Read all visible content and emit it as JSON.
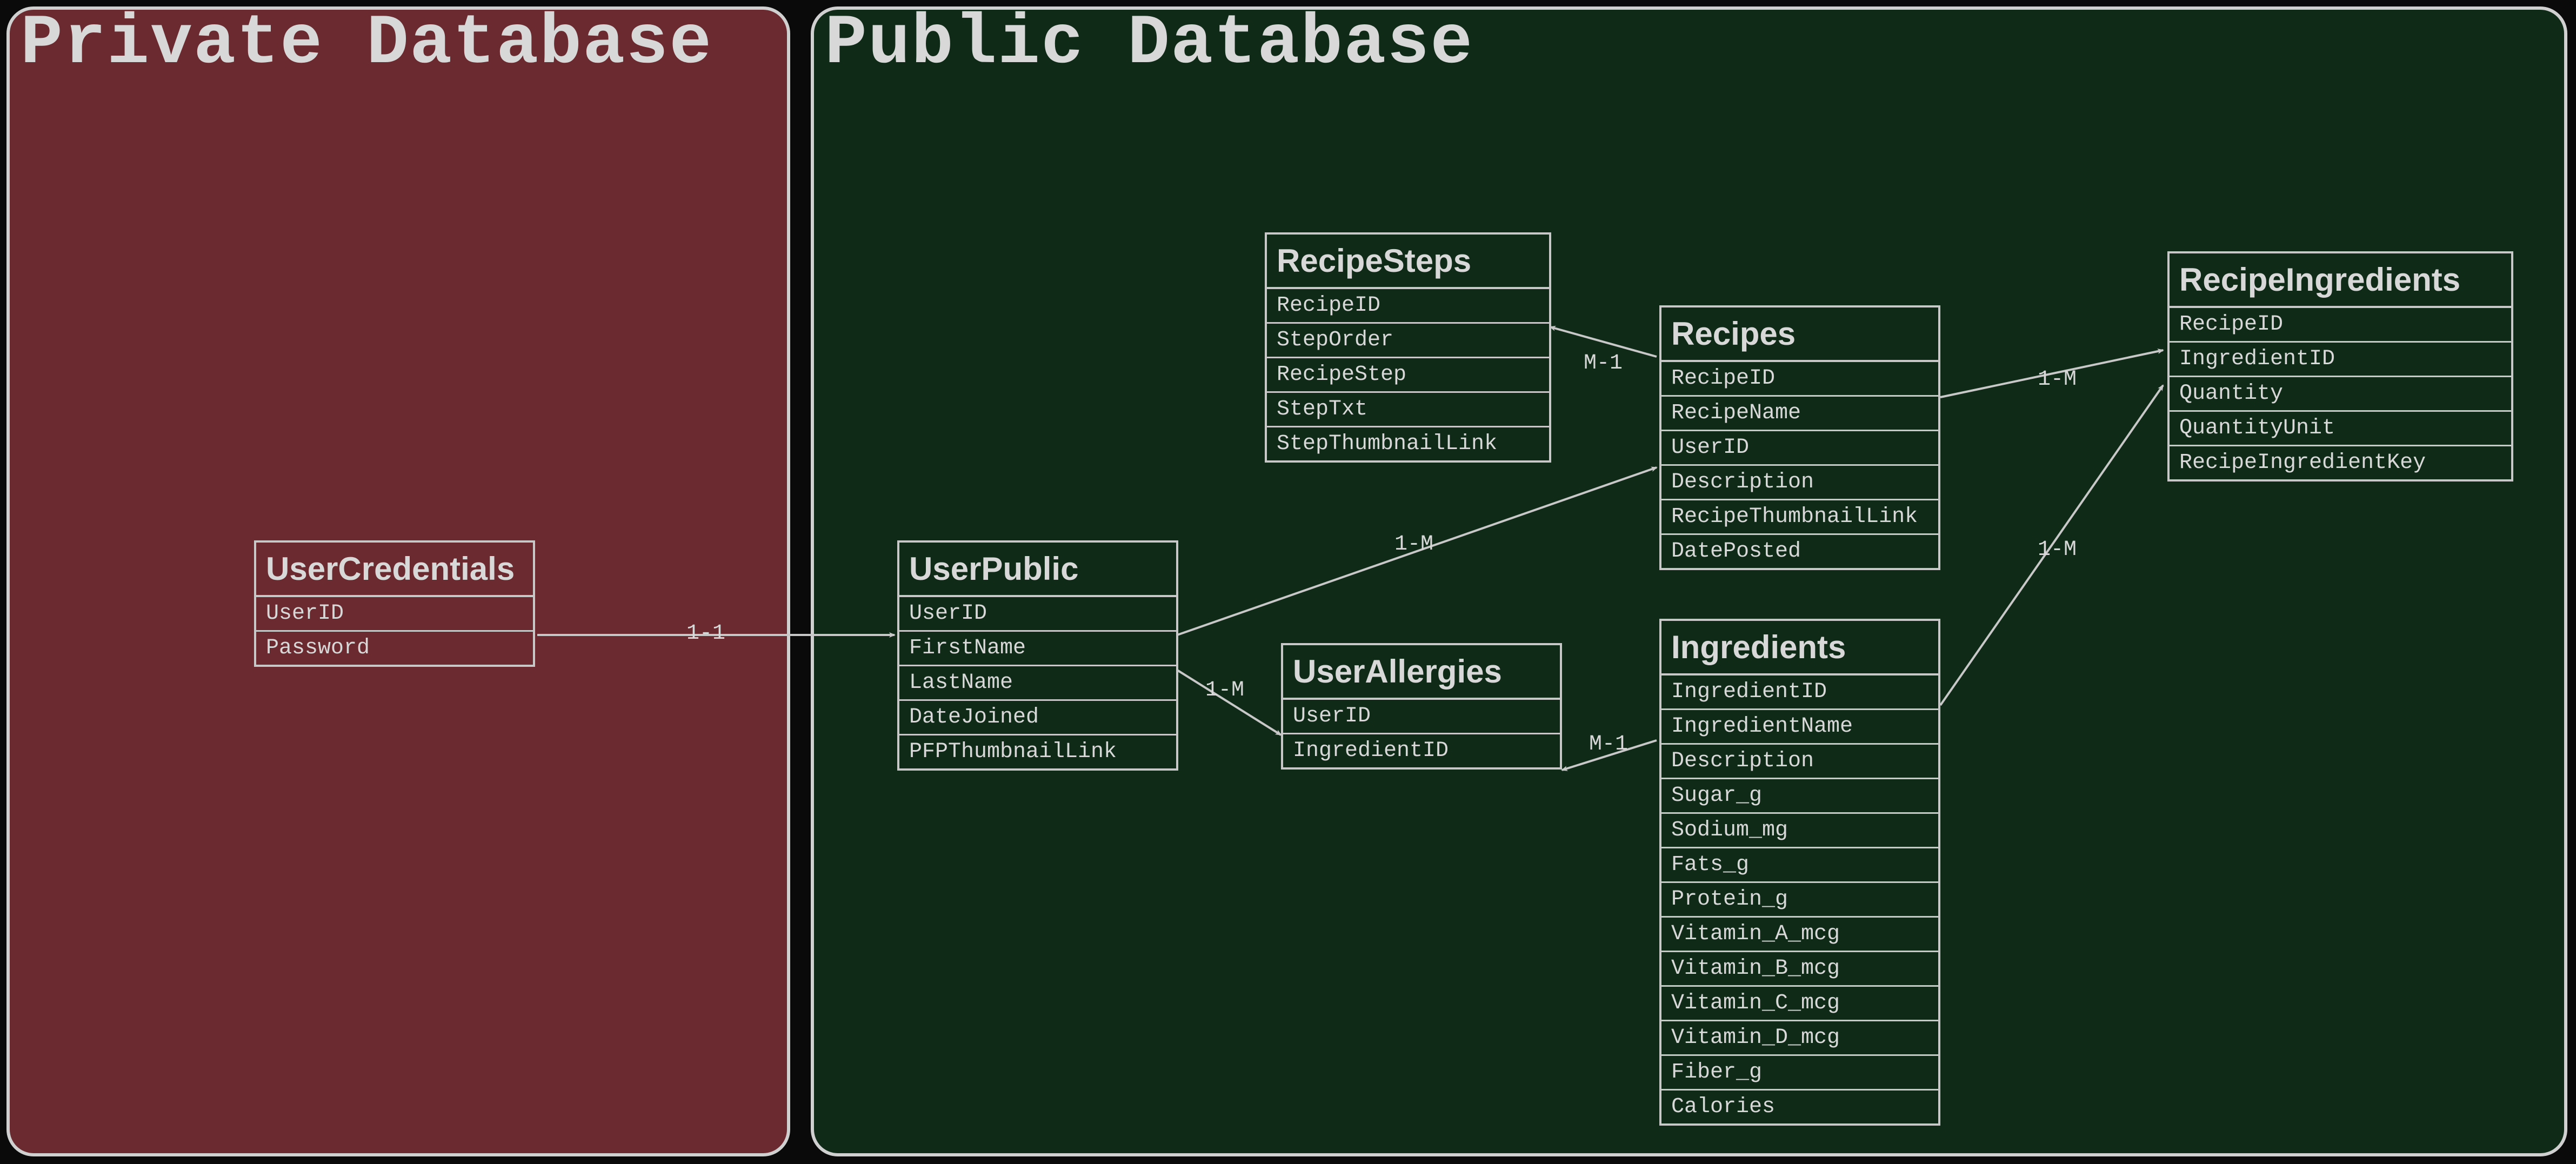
{
  "databases": {
    "private": {
      "title": "Private Database"
    },
    "public": {
      "title": "Public Database"
    }
  },
  "entities": {
    "userCredentials": {
      "title": "UserCredentials",
      "fields": [
        "UserID",
        "Password"
      ]
    },
    "userPublic": {
      "title": "UserPublic",
      "fields": [
        "UserID",
        "FirstName",
        "LastName",
        "DateJoined",
        "PFPThumbnailLink"
      ]
    },
    "recipeSteps": {
      "title": "RecipeSteps",
      "fields": [
        "RecipeID",
        "StepOrder",
        "RecipeStep",
        "StepTxt",
        "StepThumbnailLink"
      ]
    },
    "recipes": {
      "title": "Recipes",
      "fields": [
        "RecipeID",
        "RecipeName",
        "UserID",
        "Description",
        "RecipeThumbnailLink",
        "DatePosted"
      ]
    },
    "userAllergies": {
      "title": "UserAllergies",
      "fields": [
        "UserID",
        "IngredientID"
      ]
    },
    "ingredients": {
      "title": "Ingredients",
      "fields": [
        "IngredientID",
        "IngredientName",
        "Description",
        "Sugar_g",
        "Sodium_mg",
        "Fats_g",
        "Protein_g",
        "Vitamin_A_mcg",
        "Vitamin_B_mcg",
        "Vitamin_C_mcg",
        "Vitamin_D_mcg",
        "Fiber_g",
        "Calories"
      ]
    },
    "recipeIngredients": {
      "title": "RecipeIngredients",
      "fields": [
        "RecipeID",
        "IngredientID",
        "Quantity",
        "QuantityUnit",
        "RecipeIngredientKey"
      ]
    }
  },
  "relationships": {
    "userCred_userPublic": "1-1",
    "userPublic_recipes": "1-M",
    "userPublic_allergies": "1-M",
    "recipes_steps": "M-1",
    "recipes_recipeIng": "1-M",
    "ingredients_recipeIng": "1-M",
    "ingredients_allergies": "M-1"
  }
}
